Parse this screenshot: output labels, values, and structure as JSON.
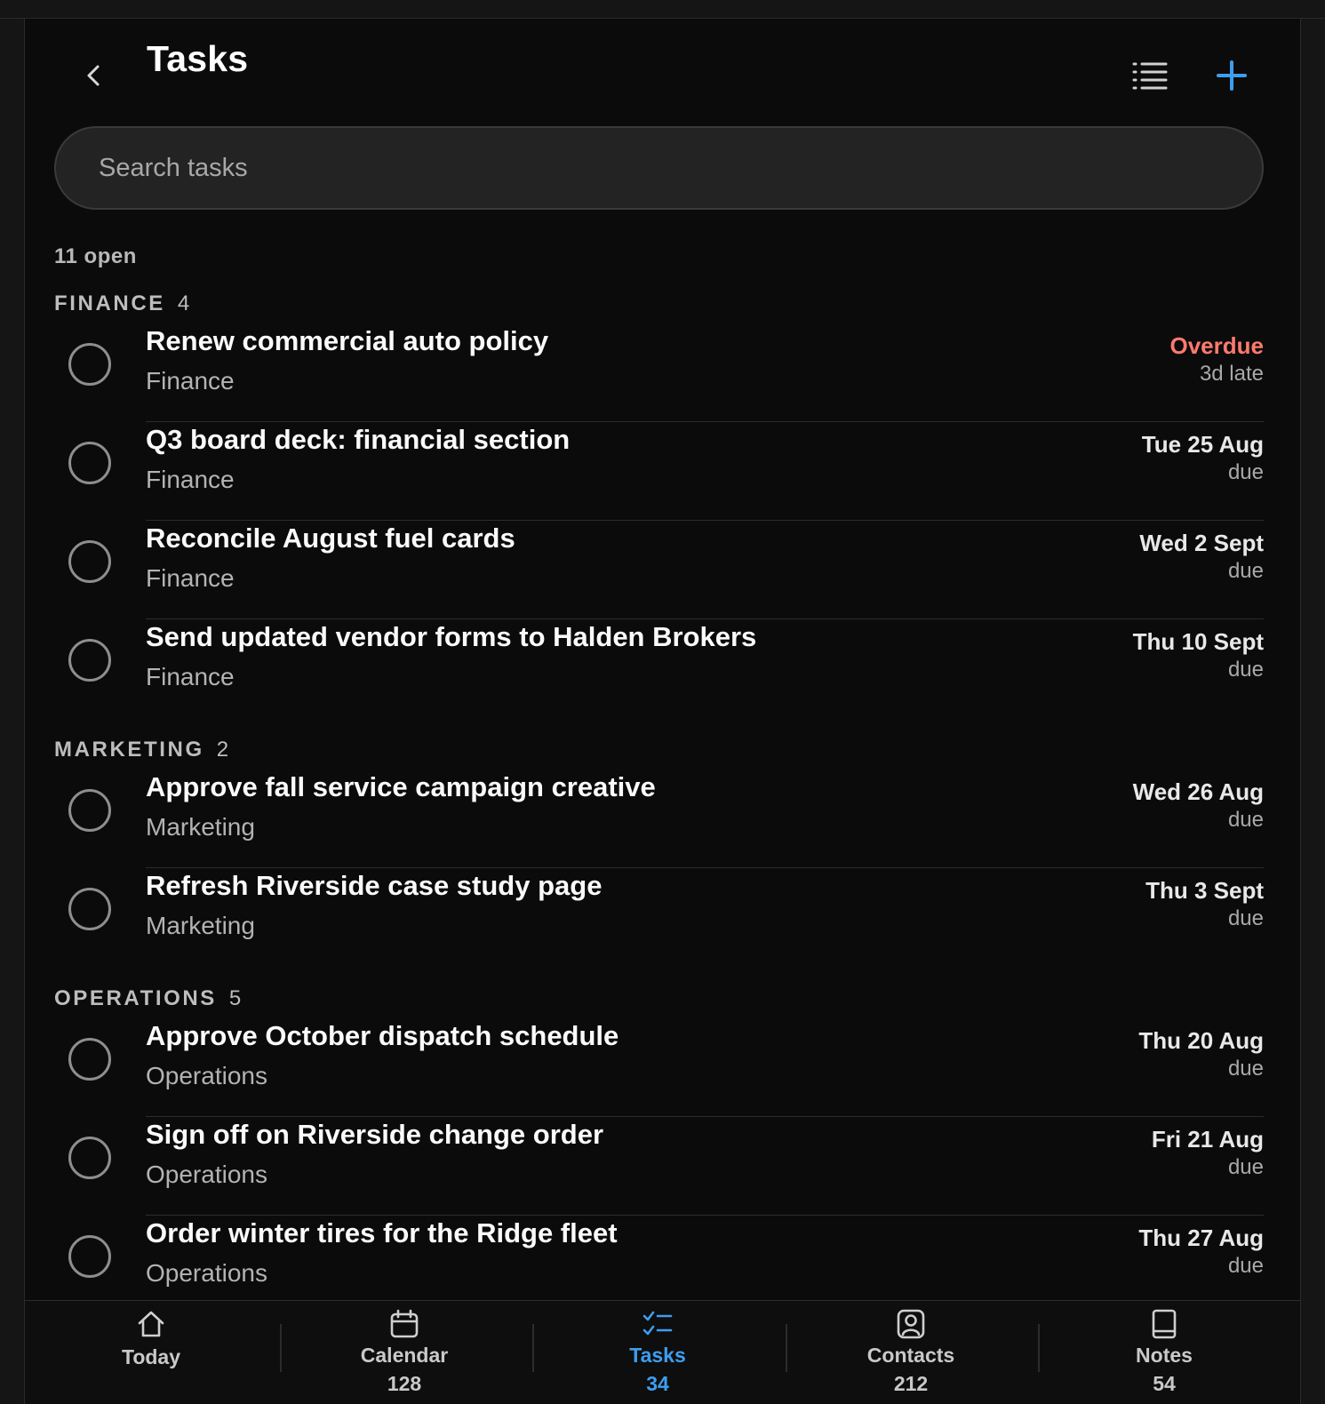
{
  "header": {
    "title": "Tasks",
    "back_icon": "chevron-left-icon",
    "list_icon": "list-icon",
    "add_icon": "plus-icon"
  },
  "search": {
    "placeholder": "Search tasks",
    "value": ""
  },
  "summary": {
    "open_count": "11 open"
  },
  "colors": {
    "accent": "#3d9ef0",
    "overdue": "#ff7a6e",
    "background": "#0b0b0b"
  },
  "sections": [
    {
      "name": "FINANCE",
      "count": "4",
      "tasks": [
        {
          "title": "Renew commercial auto policy",
          "category": "Finance",
          "due": "Overdue",
          "due_sub": "3d late",
          "overdue": true
        },
        {
          "title": "Q3 board deck: financial section",
          "category": "Finance",
          "due": "Tue 25 Aug",
          "due_sub": "due"
        },
        {
          "title": "Reconcile August fuel cards",
          "category": "Finance",
          "due": "Wed 2 Sept",
          "due_sub": "due"
        },
        {
          "title": "Send updated vendor forms to Halden Brokers",
          "category": "Finance",
          "due": "Thu 10 Sept",
          "due_sub": "due"
        }
      ]
    },
    {
      "name": "MARKETING",
      "count": "2",
      "tasks": [
        {
          "title": "Approve fall service campaign creative",
          "category": "Marketing",
          "due": "Wed 26 Aug",
          "due_sub": "due"
        },
        {
          "title": "Refresh Riverside case study page",
          "category": "Marketing",
          "due": "Thu 3 Sept",
          "due_sub": "due"
        }
      ]
    },
    {
      "name": "OPERATIONS",
      "count": "5",
      "tasks": [
        {
          "title": "Approve October dispatch schedule",
          "category": "Operations",
          "due": "Thu 20 Aug",
          "due_sub": "due"
        },
        {
          "title": "Sign off on Riverside change order",
          "category": "Operations",
          "due": "Fri 21 Aug",
          "due_sub": "due"
        },
        {
          "title": "Order winter tires for the Ridge fleet",
          "category": "Operations",
          "due": "Thu 27 Aug",
          "due_sub": "due"
        }
      ]
    }
  ],
  "nav": [
    {
      "label": "Today",
      "count": "",
      "icon": "home-icon"
    },
    {
      "label": "Calendar",
      "count": "128",
      "icon": "calendar-icon"
    },
    {
      "label": "Tasks",
      "count": "34",
      "icon": "tasks-icon",
      "active": true
    },
    {
      "label": "Contacts",
      "count": "212",
      "icon": "contacts-icon"
    },
    {
      "label": "Notes",
      "count": "54",
      "icon": "notes-icon"
    }
  ]
}
